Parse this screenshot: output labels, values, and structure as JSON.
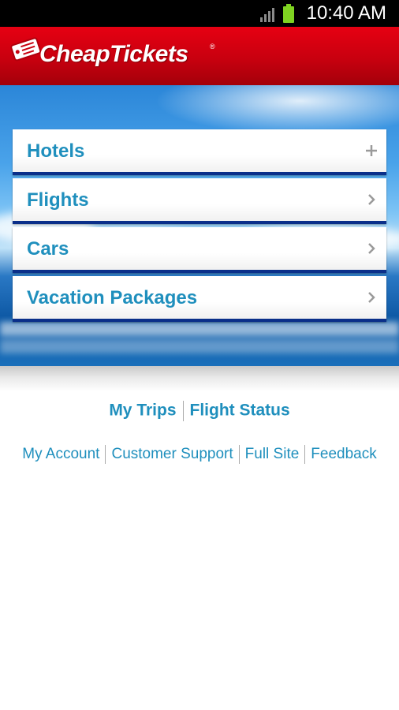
{
  "status_bar": {
    "time": "10:40 AM",
    "icons": [
      "signal-icon",
      "battery-icon"
    ]
  },
  "header": {
    "brand": "CheapTickets",
    "registered_mark": "®"
  },
  "menu": {
    "items": [
      {
        "label": "Hotels",
        "indicator": "plus-icon"
      },
      {
        "label": "Flights",
        "indicator": "chevron-right-icon"
      },
      {
        "label": "Cars",
        "indicator": "chevron-right-icon"
      },
      {
        "label": "Vacation Packages",
        "indicator": "chevron-right-icon"
      }
    ]
  },
  "primary_links": {
    "my_trips": "My Trips",
    "flight_status": "Flight Status"
  },
  "secondary_links": {
    "my_account": "My Account",
    "customer_support": "Customer Support",
    "full_site": "Full Site",
    "feedback": "Feedback"
  },
  "colors": {
    "header_red": "#d4000f",
    "link_blue": "#1f8fbd",
    "menu_border": "#0a2f8a",
    "battery_green": "#7fd321"
  }
}
